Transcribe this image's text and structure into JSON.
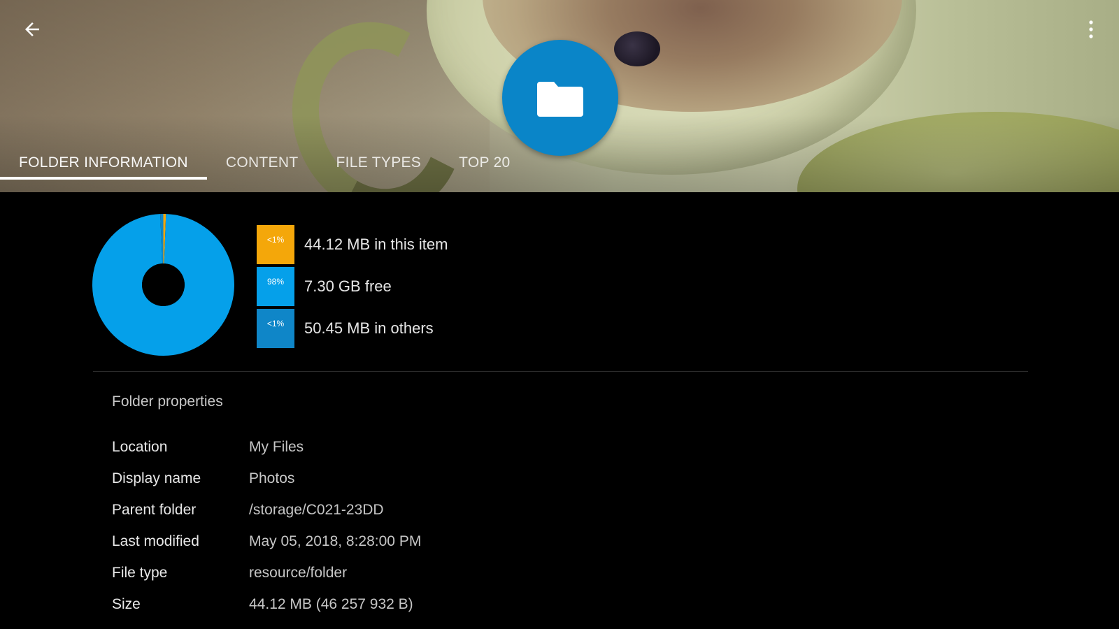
{
  "tabs": [
    {
      "label": "FOLDER INFORMATION",
      "active": true
    },
    {
      "label": "CONTENT",
      "active": false
    },
    {
      "label": "FILE TYPES",
      "active": false
    },
    {
      "label": "TOP 20",
      "active": false
    }
  ],
  "icons": {
    "back": "arrow-left-icon",
    "more": "more-vertical-icon",
    "folder": "folder-icon"
  },
  "colors": {
    "fab": "#0a85c8",
    "this_item": "#f4a70a",
    "free": "#05a0ea",
    "others": "#0f86c8",
    "tab_indicator": "#ffffff"
  },
  "storage": {
    "items": [
      {
        "badge": "<1%",
        "label": "44.12 MB in this item",
        "color": "#f4a70a",
        "fraction": 0.006
      },
      {
        "badge": "98%",
        "label": "7.30 GB free",
        "color": "#05a0ea",
        "fraction": 0.987
      },
      {
        "badge": "<1%",
        "label": "50.45 MB in others",
        "color": "#0f86c8",
        "fraction": 0.007
      }
    ]
  },
  "properties": {
    "title": "Folder properties",
    "rows": [
      {
        "key": "Location",
        "value": "My Files"
      },
      {
        "key": "Display name",
        "value": "Photos"
      },
      {
        "key": "Parent folder",
        "value": "/storage/C021-23DD"
      },
      {
        "key": "Last modified",
        "value": "May 05, 2018, 8:28:00 PM"
      },
      {
        "key": "File type",
        "value": "resource/folder"
      },
      {
        "key": "Size",
        "value": "44.12 MB (46 257 932 B)"
      }
    ]
  }
}
